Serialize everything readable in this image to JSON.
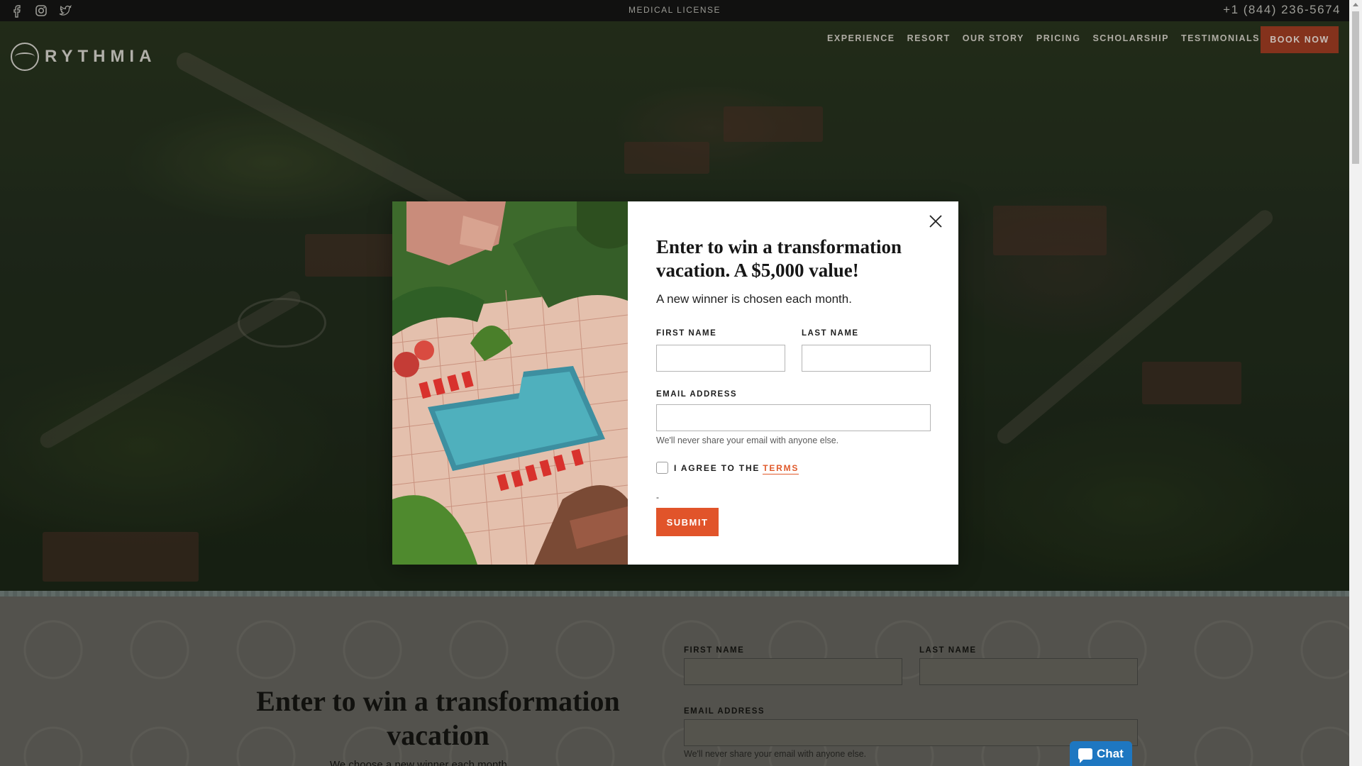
{
  "topbar": {
    "social_icons": [
      "facebook-icon",
      "instagram-icon",
      "twitter-icon"
    ],
    "center_link": "MEDICAL LICENSE",
    "phone": "+1 (844) 236-5674"
  },
  "header": {
    "logo_text": "RYTHMIA",
    "nav": [
      "EXPERIENCE",
      "RESORT",
      "OUR STORY",
      "PRICING",
      "SCHOLARSHIP",
      "TESTIMONIALS"
    ],
    "book_now": "BOOK NOW"
  },
  "modal": {
    "title": "Enter to win a transformation vacation. A $5,000 value!",
    "lede": "A new winner is chosen each month.",
    "first_name_label": "FIRST NAME",
    "last_name_label": "LAST NAME",
    "email_label": "EMAIL ADDRESS",
    "first_name_value": "",
    "last_name_value": "",
    "email_value": "",
    "email_hint": "We'll never share your email with anyone else.",
    "agree_text": "I AGREE TO THE",
    "terms_link": "TERMS",
    "dash": "-",
    "submit": "SUBMIT"
  },
  "lower": {
    "title": "Enter to win a transformation vacation",
    "subtitle": "We choose a new winner each month",
    "first_name_label": "FIRST NAME",
    "last_name_label": "LAST NAME",
    "email_label": "EMAIL ADDRESS",
    "email_hint": "We'll never share your email with anyone else."
  },
  "chat": {
    "label": "Chat"
  },
  "colors": {
    "accent": "#e1542a",
    "book_now_bg": "#a13e23",
    "chat_bg": "#1e77c1"
  }
}
